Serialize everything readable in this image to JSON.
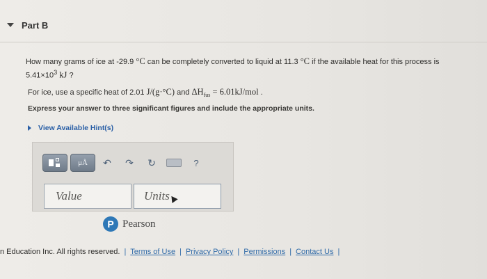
{
  "part": {
    "title": "Part B"
  },
  "question": {
    "text_before": "How many grams of ice at -29.9 ",
    "unit_c1": "°C",
    "text_mid": " can be completely converted to liquid at 11.3 ",
    "unit_c2": "°C",
    "text_after": " if the available heat for this process is 5.41×10",
    "exponent": "3",
    "unit_kj": " kJ",
    "end": " ?"
  },
  "given": {
    "text1": "For ice, use a specific heat of 2.01 ",
    "specific_heat_unit": "J/(g·°C)",
    "text2": " and ",
    "enthalpy": "ΔH",
    "enthalpy_sub": "fus",
    "enthalpy_value": " = 6.01kJ/mol",
    "end": " ."
  },
  "instructions": "Express your answer to three significant figures and include the appropriate units.",
  "hint": {
    "label": "View Available Hint(s)"
  },
  "toolbar": {
    "mu_label": "μÅ",
    "undo": "↶",
    "redo": "↷",
    "reset": "↻",
    "help": "?"
  },
  "answer": {
    "value_placeholder": "Value",
    "units_placeholder": "Units"
  },
  "brand": {
    "name": "Pearson",
    "logo_letter": "P",
    "color": "#2e78b7"
  },
  "footer": {
    "copyright": "n Education Inc. All rights reserved.",
    "separator": "|",
    "links": [
      "Terms of Use",
      "Privacy Policy",
      "Permissions",
      "Contact Us"
    ]
  }
}
